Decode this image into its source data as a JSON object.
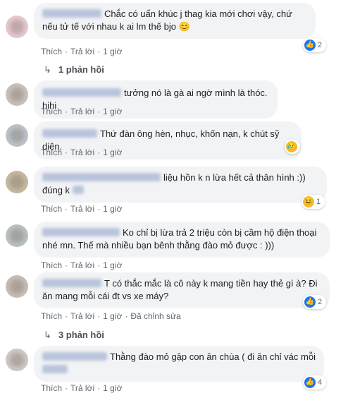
{
  "colors": {
    "link": "#606770",
    "bubble": "#f2f3f5",
    "like": "#1877f2"
  },
  "comments": [
    {
      "text": "Chắc có uẩn khúc j thag kia mới chơi vậy, chứ nếu tử tế với nhau k ai lm thế bjo 😊",
      "like": "Thích",
      "reply": "Trả lời",
      "time": "1 giờ",
      "reaction_icon": "like-icon",
      "reaction_count": "2"
    },
    {
      "text": "tưởng nó là gà ai ngờ mình là thóc. hihi",
      "like": "Thích",
      "reply": "Trả lời",
      "time": "1 giờ"
    },
    {
      "text": "Thứ đàn ông hèn, nhục, khốn nạn, k chút sỹ diện.",
      "like": "Thích",
      "reply": "Trả lời",
      "time": "1 giờ",
      "reaction_icon": "sad-icon"
    },
    {
      "text": "liệu hồn k n lừa hết cả thân hình :))",
      "text2": "đúng k",
      "like": "Thích",
      "reply": "Trả lời",
      "time": "1 giờ",
      "reaction_icon": "haha-icon",
      "reaction_count": "1"
    },
    {
      "text": "Ko chỉ bị lừa trả 2 triệu còn bị cầm hộ điện thoại",
      "text2": "nhé mn. Thế mà nhiều bạn bênh thằng đào mỏ được : )))",
      "like": "Thích",
      "reply": "Trả lời",
      "time": "1 giờ"
    },
    {
      "text": "T có thắc mắc là cô này k mang tiền hay thẻ gì à? Đi",
      "text2": "ăn mang mỗi cái đt vs xe máy?",
      "like": "Thích",
      "reply": "Trả lời",
      "time": "1 giờ",
      "edited": "Đã chỉnh sửa",
      "reaction_icon": "like-icon",
      "reaction_count": "2"
    },
    {
      "text": "Thằng đào mỏ gặp con ăn chùa ( đi ăn chỉ vác mỗi",
      "like": "Thích",
      "reply": "Trả lời",
      "time": "1 giờ",
      "reaction_icon": "like-icon",
      "reaction_count": "4"
    }
  ],
  "replies": [
    {
      "label": "1 phản hồi"
    },
    {
      "label": "3 phản hồi"
    }
  ]
}
